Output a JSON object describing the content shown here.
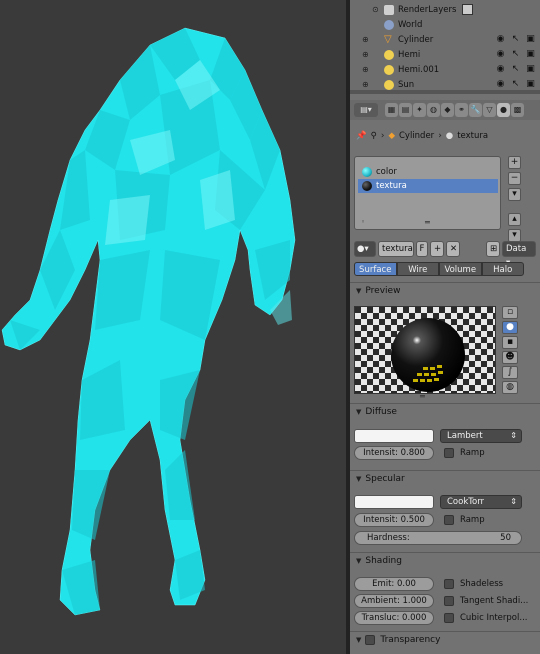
{
  "outliner": {
    "items": [
      {
        "label": "RenderLayers",
        "icon": "render-layers-icon",
        "color": "#d0d0d0"
      },
      {
        "label": "World",
        "icon": "world-icon",
        "color": "#8aa0c8"
      },
      {
        "label": "Cylinder",
        "icon": "mesh-object-icon",
        "color": "#f0a030"
      },
      {
        "label": "Hemi",
        "icon": "lamp-icon",
        "color": "#f0d050"
      },
      {
        "label": "Hemi.001",
        "icon": "lamp-icon",
        "color": "#f0d050"
      },
      {
        "label": "Sun",
        "icon": "lamp-icon",
        "color": "#f0d050"
      }
    ]
  },
  "breadcrumb": {
    "object": "Cylinder",
    "material": "textura"
  },
  "material_slots": [
    {
      "label": "color",
      "ball_color": "#1fb5c8"
    },
    {
      "label": "textura",
      "ball_color": "#111111"
    }
  ],
  "datablock": {
    "name": "textura",
    "fake_user": "F",
    "link": "Data"
  },
  "type_tabs": [
    {
      "label": "Surface",
      "active": true
    },
    {
      "label": "Wire",
      "active": false
    },
    {
      "label": "Volume",
      "active": false
    },
    {
      "label": "Halo",
      "active": false
    }
  ],
  "sections": {
    "preview": "Preview",
    "diffuse": "Diffuse",
    "specular": "Specular",
    "shading": "Shading",
    "transparency": "Transparency"
  },
  "diffuse": {
    "shader": "Lambert",
    "intensity": "Intensit: 0.800",
    "ramp": "Ramp",
    "color": "#f4f4f4"
  },
  "specular": {
    "shader": "CookTorr",
    "intensity": "Intensit: 0.500",
    "ramp": "Ramp",
    "hardness_label": "Hardness:",
    "hardness_value": "50",
    "color": "#f4f4f4"
  },
  "shading": {
    "emit": "Emit:       0.00",
    "ambient": "Ambient: 1.000",
    "transluc": "Transluc: 0.000",
    "shadeless": "Shadeless",
    "tangent": "Tangent Shadi...",
    "cubic": "Cubic Interpol..."
  },
  "colors": {
    "mesh": "#22e0e8",
    "accent": "#5680c2"
  }
}
